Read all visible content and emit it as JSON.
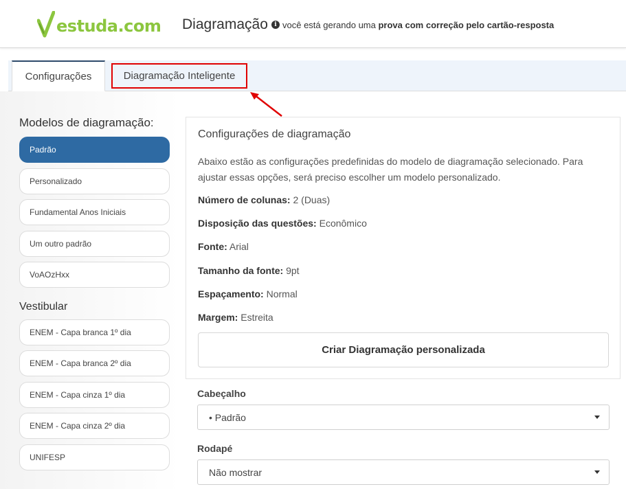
{
  "header": {
    "logo_text": "estuda.com",
    "title": "Diagramação",
    "subtitle_prefix": "você está gerando uma ",
    "subtitle_bold": "prova com correção pelo cartão-resposta",
    "brand_color": "#8cc63f"
  },
  "tabs": [
    {
      "label": "Configurações"
    },
    {
      "label": "Diagramação Inteligente"
    }
  ],
  "sidebar": {
    "models_heading": "Modelos de diagramação:",
    "models": [
      {
        "label": "Padrão"
      },
      {
        "label": "Personalizado"
      },
      {
        "label": "Fundamental Anos Iniciais"
      },
      {
        "label": "Um outro padrão"
      },
      {
        "label": "VoAOzHxx"
      }
    ],
    "vestibular_heading": "Vestibular",
    "vestibular": [
      {
        "label": "ENEM - Capa branca 1º dia"
      },
      {
        "label": "ENEM - Capa branca 2º dia"
      },
      {
        "label": "ENEM - Capa cinza 1º dia"
      },
      {
        "label": "ENEM - Capa cinza 2º dia"
      },
      {
        "label": "UNIFESP"
      }
    ],
    "active_color": "#2e6aa3"
  },
  "panel": {
    "title": "Configurações de diagramação",
    "description": "Abaixo estão as configurações predefinidas do modelo de diagramação selecionado. Para ajustar essas opções, será preciso escolher um modelo personalizado.",
    "props": [
      {
        "label": "Número de colunas:",
        "value": " 2 (Duas)"
      },
      {
        "label": "Disposição das questões:",
        "value": " Econômico"
      },
      {
        "label": "Fonte:",
        "value": " Arial"
      },
      {
        "label": "Tamanho da fonte:",
        "value": " 9pt"
      },
      {
        "label": "Espaçamento:",
        "value": " Normal"
      },
      {
        "label": "Margem:",
        "value": " Estreita"
      }
    ],
    "button_label": "Criar Diagramação personalizada"
  },
  "fields": {
    "header_label": "Cabeçalho",
    "header_value": "• Padrão",
    "footer_label": "Rodapé",
    "footer_value": "Não mostrar"
  },
  "highlight_color": "#e00000"
}
